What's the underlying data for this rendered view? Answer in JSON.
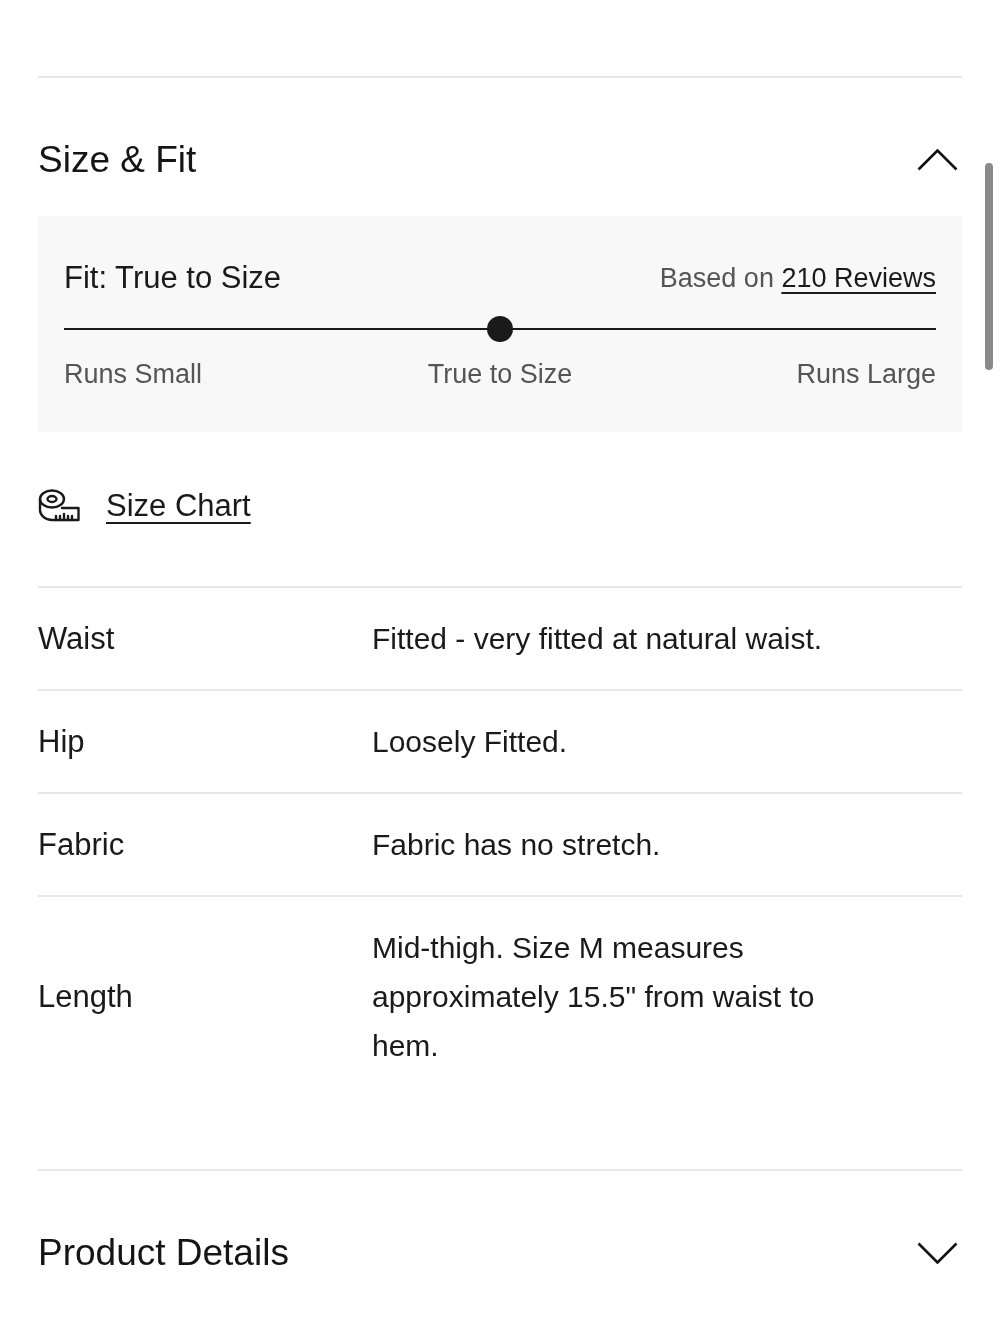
{
  "size_fit": {
    "title": "Size & Fit",
    "expanded": true,
    "fit_summary": {
      "title": "Fit: True to Size",
      "reviews_text": "Based on",
      "reviews_link": "210 Reviews",
      "level": 0.5,
      "scale_labels": [
        "Runs Small",
        "True to Size",
        "Runs Large"
      ]
    },
    "size_chart_link": "Size Chart",
    "attributes": [
      {
        "label": "Waist",
        "value": "Fitted - very fitted at natural waist."
      },
      {
        "label": "Hip",
        "value": "Loosely Fitted."
      },
      {
        "label": "Fabric",
        "value": "Fabric has no stretch."
      },
      {
        "label": "Length",
        "value": "Mid-thigh. Size M measures approximately 15.5\" from waist to hem."
      }
    ]
  },
  "product_details": {
    "title": "Product Details",
    "expanded": false
  }
}
